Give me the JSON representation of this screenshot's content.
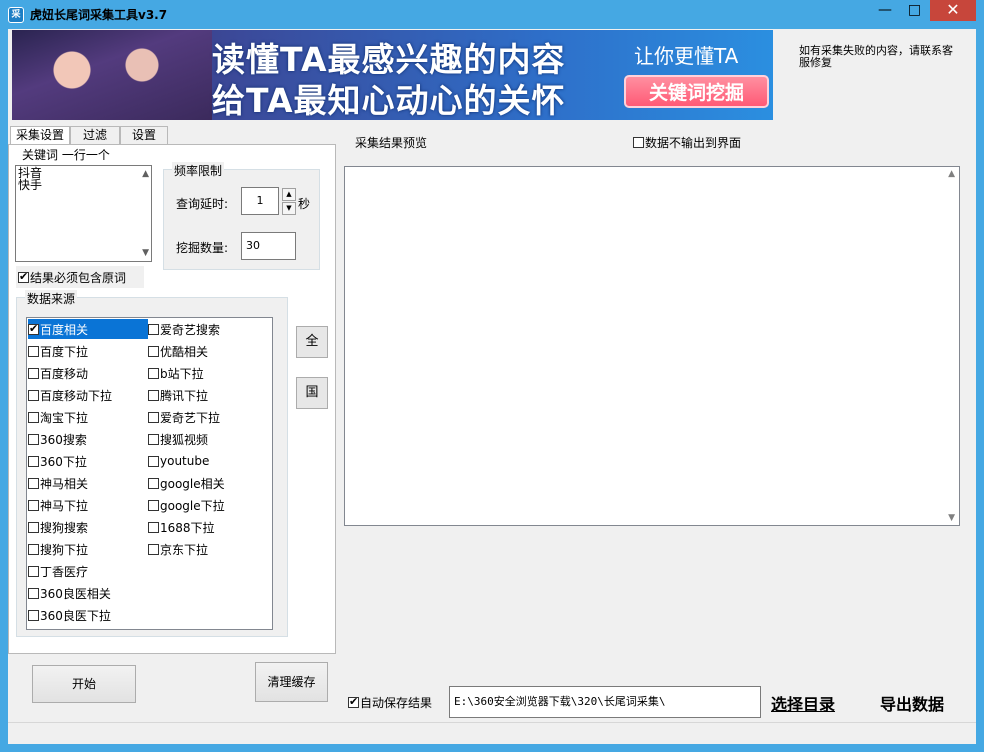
{
  "window": {
    "title": "虎妞长尾词采集工具v3.7",
    "icon": "app-icon",
    "controls": {
      "minimize": "—",
      "maximize": "□",
      "close": "✕"
    }
  },
  "banner": {
    "line1": "读懂TA最感兴趣的内容",
    "line2": "给TA最知心动心的关怀",
    "right_text": "让你更懂TA",
    "cta": "关键词挖掘"
  },
  "notice": "如有采集失败的内容，请联系客服修复",
  "tabs": [
    {
      "label": "采集设置",
      "active": true
    },
    {
      "label": "过滤",
      "active": false
    },
    {
      "label": "设置",
      "active": false
    }
  ],
  "keywords": {
    "legend": "关键词 一行一个",
    "lines": [
      "抖音",
      "快手"
    ]
  },
  "frequency": {
    "legend": "频率限制",
    "delay_label": "查询延时:",
    "delay_value": "1",
    "delay_unit": "秒",
    "count_label": "挖掘数量:",
    "count_value": "30"
  },
  "must_contain": {
    "label": "结果必须包含原词",
    "checked": true
  },
  "sources": {
    "legend": "数据来源",
    "items": [
      {
        "label": "百度相关",
        "checked": true,
        "selected": true
      },
      {
        "label": "爱奇艺搜索",
        "checked": false
      },
      {
        "label": "百度下拉",
        "checked": false
      },
      {
        "label": "优酷相关",
        "checked": false
      },
      {
        "label": "百度移动",
        "checked": false
      },
      {
        "label": "b站下拉",
        "checked": false
      },
      {
        "label": "百度移动下拉",
        "checked": false
      },
      {
        "label": "腾讯下拉",
        "checked": false
      },
      {
        "label": "淘宝下拉",
        "checked": false
      },
      {
        "label": "爱奇艺下拉",
        "checked": false
      },
      {
        "label": "360搜索",
        "checked": false
      },
      {
        "label": "搜狐视频",
        "checked": false
      },
      {
        "label": "360下拉",
        "checked": false
      },
      {
        "label": "youtube",
        "checked": false
      },
      {
        "label": "神马相关",
        "checked": false
      },
      {
        "label": "google相关",
        "checked": false
      },
      {
        "label": "神马下拉",
        "checked": false
      },
      {
        "label": "google下拉",
        "checked": false
      },
      {
        "label": "搜狗搜索",
        "checked": false
      },
      {
        "label": "1688下拉",
        "checked": false
      },
      {
        "label": "搜狗下拉",
        "checked": false
      },
      {
        "label": "京东下拉",
        "checked": false
      },
      {
        "label": "丁香医疗",
        "checked": false
      },
      {
        "label": "360良医相关",
        "checked": false
      },
      {
        "label": "360良医下拉",
        "checked": false
      }
    ],
    "select_all": "全",
    "select_domestic": "国"
  },
  "preview": {
    "title": "采集结果预览",
    "no_output_label": "数据不输出到界面",
    "no_output_checked": false
  },
  "actions": {
    "start": "开始",
    "clear_cache": "清理缓存",
    "autosave_label": "自动保存结果",
    "autosave_checked": true,
    "path": "E:\\360安全浏览器下载\\320\\长尾词采集\\",
    "choose_dir": "选择目录",
    "export": "导出数据"
  },
  "colors": {
    "titlebar": "#45a8e3",
    "close_button": "#c7463b",
    "selection": "#0a74d6"
  }
}
